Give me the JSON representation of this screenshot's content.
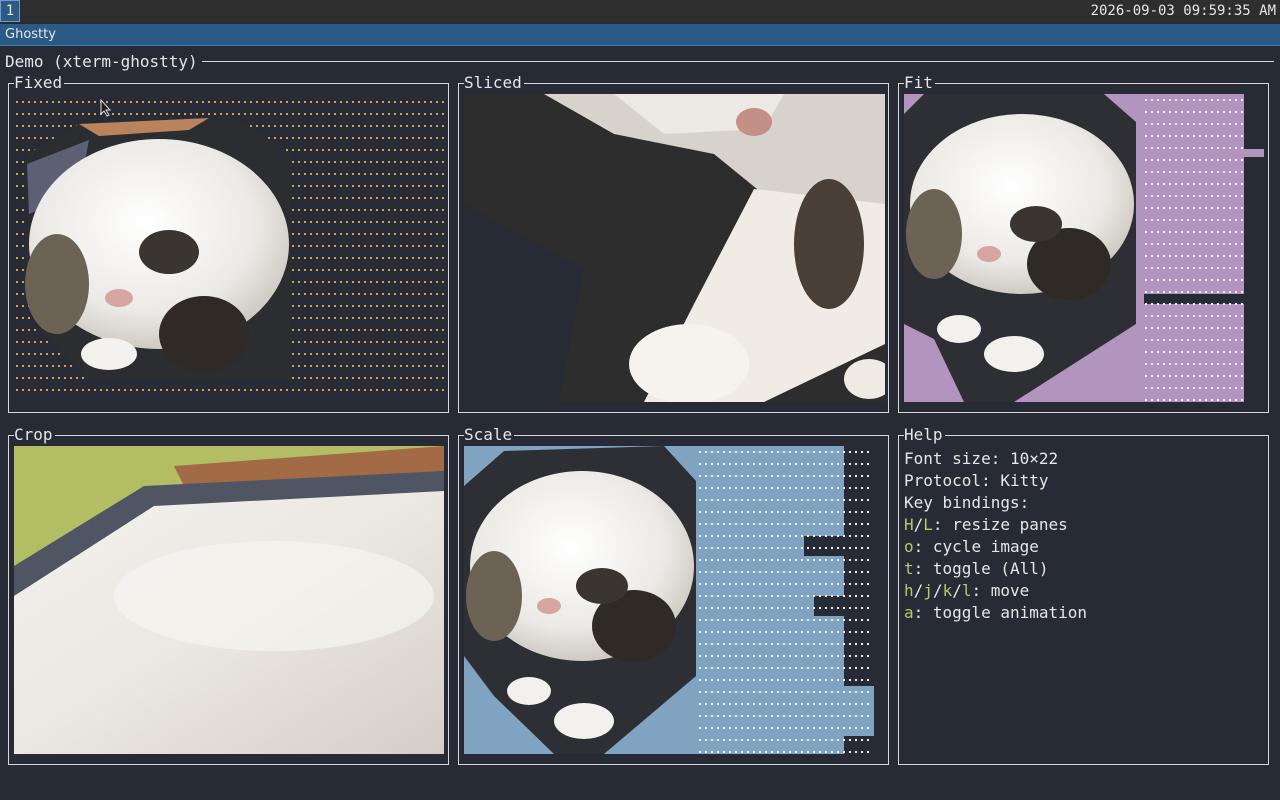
{
  "taskbar": {
    "workspace": "1",
    "clock": "2026-09-03 09:59:35 AM"
  },
  "window": {
    "title": "Ghostty"
  },
  "demo": {
    "title": "Demo (xterm-ghostty)"
  },
  "panes": {
    "fixed": "Fixed",
    "sliced": "Sliced",
    "fit": "Fit",
    "crop": "Crop",
    "scale": "Scale",
    "help": "Help"
  },
  "help": {
    "font_size": "Font size: 10×22",
    "protocol": "Protocol: Kitty",
    "key_bindings": "Key bindings:",
    "bindings": [
      {
        "sep": "/",
        "k1": "H",
        "k2": "L",
        "desc": ": resize panes"
      },
      {
        "k1": "o",
        "desc": ": cycle image"
      },
      {
        "k1": "t",
        "desc": ": toggle (All)"
      },
      {
        "k1": "h",
        "k2": "j",
        "k3": "k",
        "k4": "l",
        "sep": "/",
        "desc": ": move"
      },
      {
        "k1": "a",
        "desc": ": toggle animation"
      }
    ]
  },
  "colors": {
    "background": "#262b36",
    "titlebar": "#2b5a84",
    "key_accent": "#b5c96a",
    "fit_fill": "#b394bf",
    "scale_fill": "#7fa3c1",
    "dot_gold": "#e6b450"
  }
}
